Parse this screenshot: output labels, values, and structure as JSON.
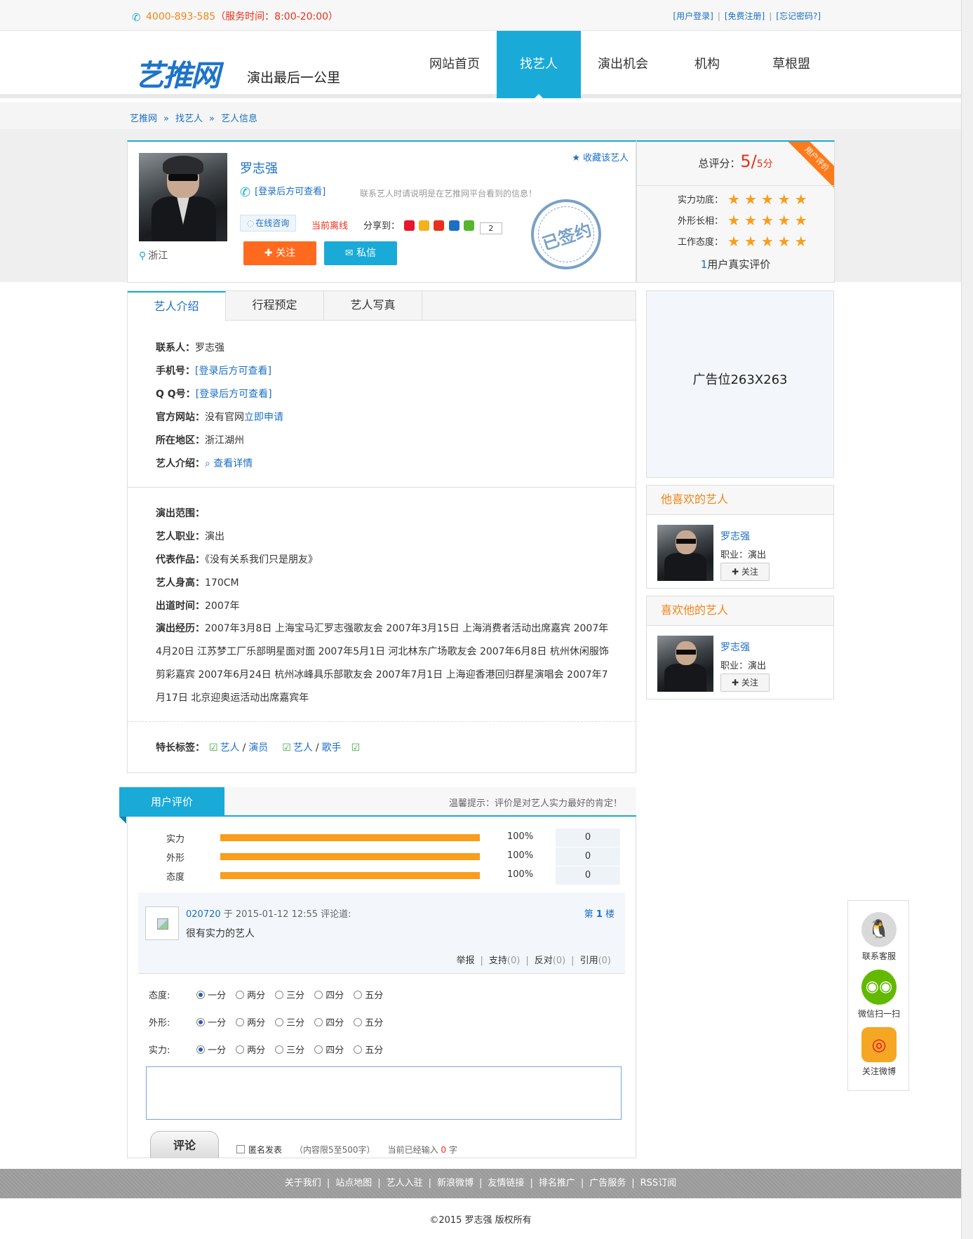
{
  "topbar": {
    "phone": "4000-893-585",
    "hours": "（服务时间：8:00-20:00）",
    "links": [
      "[用户登录]",
      "[免费注册]",
      "[忘记密码?]"
    ]
  },
  "header": {
    "logo": "艺推网",
    "slogan": "演出最后一公里",
    "nav": [
      "网站首页",
      "找艺人",
      "演出机会",
      "机构",
      "草根盟"
    ],
    "active_nav": "找艺人"
  },
  "breadcrumb": [
    "艺推网",
    "找艺人",
    "艺人信息"
  ],
  "profile": {
    "name": "罗志强",
    "phone_hidden": "[登录后方可查看]",
    "note": "联系艺人时请说明是在艺推网平台看到的信息！",
    "location": "浙江",
    "consult": "在线咨询",
    "status": "当前离线",
    "share_label": "分享到：",
    "share_count": "2",
    "follow": "关注",
    "message": "私信",
    "collect": "收藏该艺人",
    "stamp": "已签约"
  },
  "score": {
    "label": "总评分：",
    "value": "5/",
    "max": "5分",
    "ribbon": "用户评价",
    "rows": [
      {
        "label": "实力功底：",
        "stars": 5
      },
      {
        "label": "外形长相：",
        "stars": 5
      },
      {
        "label": "工作态度：",
        "stars": 5
      }
    ],
    "users_count": "1",
    "users_text": "用户真实评价"
  },
  "tabs": [
    "艺人介绍",
    "行程预定",
    "艺人写真"
  ],
  "info": {
    "contact": {
      "label": "联系人：",
      "value": "罗志强"
    },
    "mobile": {
      "label": "手机号：",
      "value": "[登录后方可查看]"
    },
    "qq": {
      "label": "Q Q号：",
      "value": "[登录后方可查看]"
    },
    "website": {
      "label": "官方网站：",
      "value": "没有官网",
      "link": "立即申请"
    },
    "region": {
      "label": "所在地区：",
      "value": "浙江湖州"
    },
    "intro": {
      "label": "艺人介绍：",
      "link": "查看详情"
    },
    "range": {
      "label": "演出范围：",
      "value": ""
    },
    "job": {
      "label": "艺人职业：",
      "value": "演出"
    },
    "works": {
      "label": "代表作品：",
      "value": "《没有关系我们只是朋友》"
    },
    "height": {
      "label": "艺人身高：",
      "value": "170CM"
    },
    "debut": {
      "label": "出道时间：",
      "value": "2007年"
    },
    "career": {
      "label": "演出经历：",
      "value": "2007年3月8日 上海宝马汇罗志强歌友会 2007年3月15日 上海消费者活动出席嘉宾 2007年4月20日 江苏梦工厂乐部明星面对面 2007年5月1日 河北林东广场歌友会 2007年6月8日 杭州休闲服饰剪彩嘉宾 2007年6月24日 杭州冰峰具乐部歌友会 2007年7月1日 上海迎香港回归群星演唱会 2007年7月17日 北京迎奥运活动出席嘉宾年"
    },
    "tags_label": "特长标签：",
    "tags": [
      [
        "艺人",
        "演员"
      ],
      [
        "艺人",
        "歌手"
      ]
    ]
  },
  "sidebar": {
    "ad": "广告位263X263",
    "liked_by_him": {
      "title": "他喜欢的艺人",
      "name": "罗志强",
      "job": "职业：演出",
      "follow": "关注"
    },
    "likes_him": {
      "title": "喜欢他的艺人",
      "name": "罗志强",
      "job": "职业：演出",
      "follow": "关注"
    }
  },
  "reviews": {
    "tab": "用户评价",
    "tip": "温馨提示：评价是对艺人实力最好的肯定！",
    "bars": [
      {
        "label": "实力",
        "percent": 100,
        "percent_text": "100%",
        "count": "0"
      },
      {
        "label": "外形",
        "percent": 100,
        "percent_text": "100%",
        "count": "0"
      },
      {
        "label": "态度",
        "percent": 100,
        "percent_text": "100%",
        "count": "0"
      }
    ],
    "comment": {
      "user": "020720",
      "at": " 于 2015-01-12 12:55 评论道:",
      "floor_pre": "第 ",
      "floor": "1",
      "floor_post": " 楼",
      "text": "很有实力的艺人",
      "actions": [
        "举报",
        "支持",
        "(0)",
        "反对",
        "(0)",
        "引用",
        "(0)"
      ]
    },
    "rating_rows": [
      {
        "label": "态度:",
        "selected": 0
      },
      {
        "label": "外形:",
        "selected": 0
      },
      {
        "label": "实力:",
        "selected": 0
      }
    ],
    "options": [
      "一分",
      "两分",
      "三分",
      "四分",
      "五分"
    ],
    "submit": "评论",
    "anon": "匿名发表",
    "limit": "（内容限5至500字）",
    "current_pre": "当前已经输入 ",
    "current": "0",
    "current_post": " 字"
  },
  "footer": {
    "links": [
      "关于我们",
      "站点地图",
      "艺人入驻",
      "新浪微博",
      "友情链接",
      "排名推广",
      "广告服务",
      "RSS订阅"
    ],
    "copyright": "©2015 罗志强 版权所有"
  },
  "floatbar": [
    {
      "label": "联系客服",
      "icon": "qq-icon",
      "color": "#d9d9d9"
    },
    {
      "label": "微信扫一扫",
      "icon": "wechat-icon",
      "color": "#62b900"
    },
    {
      "label": "关注微博",
      "icon": "weibo-icon",
      "color": "#f5a623"
    }
  ],
  "colors": {
    "accent": "#1aaad8",
    "orange": "#ff6a1f",
    "star": "#f99d1c",
    "red": "#e8301c"
  }
}
